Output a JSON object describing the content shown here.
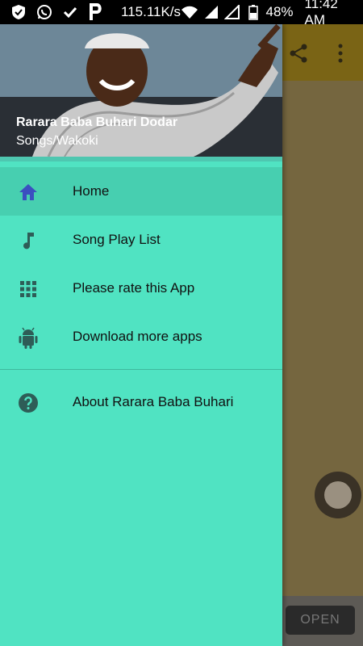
{
  "status_bar": {
    "speed": "115.11K/s",
    "battery": "48%",
    "time": "11:42 AM"
  },
  "drawer": {
    "header": {
      "title": "Rarara Baba Buhari Dodar",
      "subtitle": "Songs/Wakoki"
    },
    "items": [
      {
        "label": "Home",
        "icon": "home-icon",
        "active": true
      },
      {
        "label": "Song Play List",
        "icon": "music-note-icon"
      },
      {
        "label": "Please rate this App",
        "icon": "apps-grid-icon"
      },
      {
        "label": "Download more apps",
        "icon": "android-icon"
      },
      {
        "label": "About Rarara Baba Buhari",
        "icon": "help-icon"
      }
    ]
  },
  "background_app": {
    "open_button_label": "OPEN"
  },
  "colors": {
    "drawer_bg": "#50e3c2",
    "active_item_bg": "#47cfb0",
    "home_icon": "#3b4fc0",
    "item_icon": "#2e5d57"
  }
}
